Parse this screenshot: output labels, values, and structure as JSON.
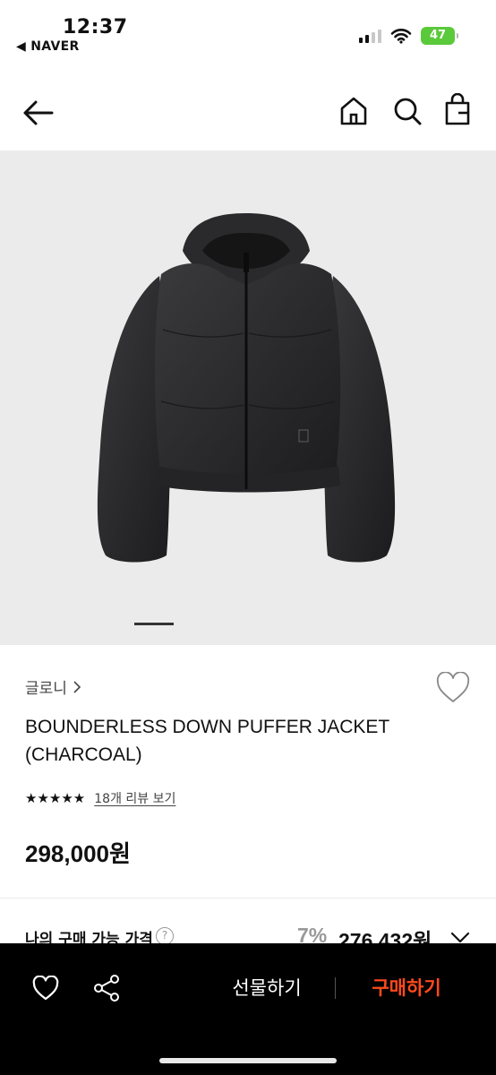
{
  "status_bar": {
    "time": "12:37",
    "back_app": "◀ NAVER",
    "battery": "47"
  },
  "nav": {
    "icons": [
      "back-arrow-icon",
      "home-icon",
      "search-icon",
      "shopping-bag-icon"
    ]
  },
  "product": {
    "image_alt": "black cropped hooded down puffer jacket",
    "brand": "글로니",
    "name": "BOUNDERLESS DOWN PUFFER JACKET (CHARCOAL)",
    "rating_stars": "★★★★★",
    "rating_value": 5,
    "review_link": "18개 리뷰 보기",
    "price": "298,000원"
  },
  "purchase_price": {
    "label": "나의 구매 가능 가격",
    "help": "?",
    "discount": "7%",
    "price": "276,432원"
  },
  "bottom_bar": {
    "gift_label": "선물하기",
    "buy_label": "구매하기",
    "colors": {
      "buy": "#ff4a1c",
      "background": "#000000"
    }
  }
}
